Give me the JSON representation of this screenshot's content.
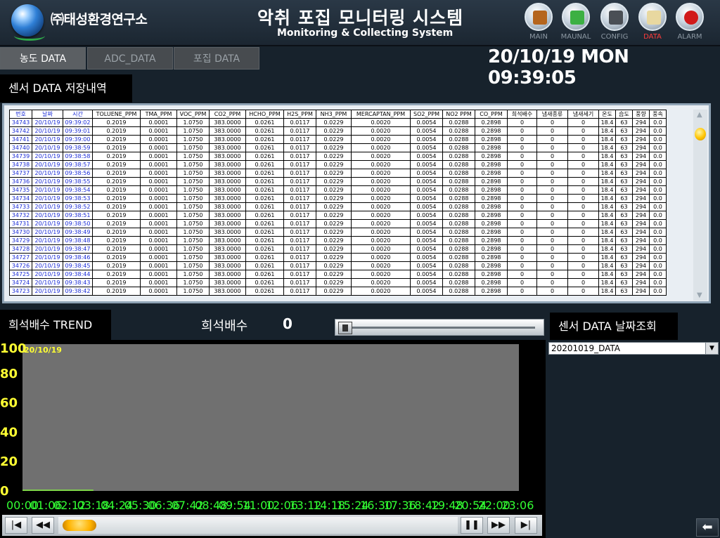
{
  "header": {
    "company": "㈜태성환경연구소",
    "title_ko": "악취 포집 모니터링 시스템",
    "title_en": "Monitoring & Collecting System",
    "nav": [
      {
        "label": "MAIN",
        "icon": "house-icon",
        "color": "#b5651d"
      },
      {
        "label": "MAUNAL",
        "icon": "book-icon",
        "color": "#3cb043"
      },
      {
        "label": "CONFIG",
        "icon": "device-icon",
        "color": "#4a4f55"
      },
      {
        "label": "DATA",
        "icon": "document-icon",
        "color": "#e8d8a0",
        "active": true
      },
      {
        "label": "ALARM",
        "icon": "alarm-icon",
        "color": "#d11a1a"
      }
    ]
  },
  "tabs": [
    {
      "label": "농도 DATA",
      "active": true
    },
    {
      "label": "ADC_DATA",
      "active": false
    },
    {
      "label": "포집 DATA",
      "active": false
    }
  ],
  "clock": {
    "date": "20/10/19",
    "day": "MON",
    "time": "09:39:05"
  },
  "sensor_section": {
    "title": "센서 DATA 저장내역"
  },
  "table": {
    "columns": [
      "번호",
      "날짜",
      "시간",
      "TOLUENE_PPM",
      "TMA_PPM",
      "VOC_PPM",
      "CO2_PPM",
      "HCHO_PPM",
      "H2S_PPM",
      "NH3_PPM",
      "MERCAPTAN_PPM",
      "SO2_PPM",
      "NO2 PPM",
      "CO_PPM",
      "희석배수",
      "냄새종류",
      "냄새세기",
      "온도",
      "습도",
      "풍향",
      "풍속"
    ],
    "rows": [
      [
        "34743",
        "20/10/19",
        "09:39:02",
        "0.2019",
        "0.0001",
        "1.0750",
        "383.0000",
        "0.0261",
        "0.0117",
        "0.0229",
        "0.0020",
        "0.0054",
        "0.0288",
        "0.2898",
        "0",
        "0",
        "0",
        "18.4",
        "63",
        "294",
        "0.0"
      ],
      [
        "34742",
        "20/10/19",
        "09:39:01",
        "0.2019",
        "0.0001",
        "1.0750",
        "383.0000",
        "0.0261",
        "0.0117",
        "0.0229",
        "0.0020",
        "0.0054",
        "0.0288",
        "0.2898",
        "0",
        "0",
        "0",
        "18.4",
        "63",
        "294",
        "0.0"
      ],
      [
        "34741",
        "20/10/19",
        "09:39:00",
        "0.2019",
        "0.0001",
        "1.0750",
        "383.0000",
        "0.0261",
        "0.0117",
        "0.0229",
        "0.0020",
        "0.0054",
        "0.0288",
        "0.2898",
        "0",
        "0",
        "0",
        "18.4",
        "63",
        "294",
        "0.0"
      ],
      [
        "34740",
        "20/10/19",
        "09:38:59",
        "0.2019",
        "0.0001",
        "1.0750",
        "383.0000",
        "0.0261",
        "0.0117",
        "0.0229",
        "0.0020",
        "0.0054",
        "0.0288",
        "0.2898",
        "0",
        "0",
        "0",
        "18.4",
        "63",
        "294",
        "0.0"
      ],
      [
        "34739",
        "20/10/19",
        "09:38:58",
        "0.2019",
        "0.0001",
        "1.0750",
        "383.0000",
        "0.0261",
        "0.0117",
        "0.0229",
        "0.0020",
        "0.0054",
        "0.0288",
        "0.2898",
        "0",
        "0",
        "0",
        "18.4",
        "63",
        "294",
        "0.0"
      ],
      [
        "34738",
        "20/10/19",
        "09:38:57",
        "0.2019",
        "0.0001",
        "1.0750",
        "383.0000",
        "0.0261",
        "0.0117",
        "0.0229",
        "0.0020",
        "0.0054",
        "0.0288",
        "0.2898",
        "0",
        "0",
        "0",
        "18.4",
        "63",
        "294",
        "0.0"
      ],
      [
        "34737",
        "20/10/19",
        "09:38:56",
        "0.2019",
        "0.0001",
        "1.0750",
        "383.0000",
        "0.0261",
        "0.0117",
        "0.0229",
        "0.0020",
        "0.0054",
        "0.0288",
        "0.2898",
        "0",
        "0",
        "0",
        "18.4",
        "63",
        "294",
        "0.0"
      ],
      [
        "34736",
        "20/10/19",
        "09:38:55",
        "0.2019",
        "0.0001",
        "1.0750",
        "383.0000",
        "0.0261",
        "0.0117",
        "0.0229",
        "0.0020",
        "0.0054",
        "0.0288",
        "0.2898",
        "0",
        "0",
        "0",
        "18.4",
        "63",
        "294",
        "0.0"
      ],
      [
        "34735",
        "20/10/19",
        "09:38:54",
        "0.2019",
        "0.0001",
        "1.0750",
        "383.0000",
        "0.0261",
        "0.0117",
        "0.0229",
        "0.0020",
        "0.0054",
        "0.0288",
        "0.2898",
        "0",
        "0",
        "0",
        "18.4",
        "63",
        "294",
        "0.0"
      ],
      [
        "34734",
        "20/10/19",
        "09:38:53",
        "0.2019",
        "0.0001",
        "1.0750",
        "383.0000",
        "0.0261",
        "0.0117",
        "0.0229",
        "0.0020",
        "0.0054",
        "0.0288",
        "0.2898",
        "0",
        "0",
        "0",
        "18.4",
        "63",
        "294",
        "0.0"
      ],
      [
        "34733",
        "20/10/19",
        "09:38:52",
        "0.2019",
        "0.0001",
        "1.0750",
        "383.0000",
        "0.0261",
        "0.0117",
        "0.0229",
        "0.0020",
        "0.0054",
        "0.0288",
        "0.2898",
        "0",
        "0",
        "0",
        "18.4",
        "63",
        "294",
        "0.0"
      ],
      [
        "34732",
        "20/10/19",
        "09:38:51",
        "0.2019",
        "0.0001",
        "1.0750",
        "383.0000",
        "0.0261",
        "0.0117",
        "0.0229",
        "0.0020",
        "0.0054",
        "0.0288",
        "0.2898",
        "0",
        "0",
        "0",
        "18.4",
        "63",
        "294",
        "0.0"
      ],
      [
        "34731",
        "20/10/19",
        "09:38:50",
        "0.2019",
        "0.0001",
        "1.0750",
        "383.0000",
        "0.0261",
        "0.0117",
        "0.0229",
        "0.0020",
        "0.0054",
        "0.0288",
        "0.2898",
        "0",
        "0",
        "0",
        "18.4",
        "63",
        "294",
        "0.0"
      ],
      [
        "34730",
        "20/10/19",
        "09:38:49",
        "0.2019",
        "0.0001",
        "1.0750",
        "383.0000",
        "0.0261",
        "0.0117",
        "0.0229",
        "0.0020",
        "0.0054",
        "0.0288",
        "0.2898",
        "0",
        "0",
        "0",
        "18.4",
        "63",
        "294",
        "0.0"
      ],
      [
        "34729",
        "20/10/19",
        "09:38:48",
        "0.2019",
        "0.0001",
        "1.0750",
        "383.0000",
        "0.0261",
        "0.0117",
        "0.0229",
        "0.0020",
        "0.0054",
        "0.0288",
        "0.2898",
        "0",
        "0",
        "0",
        "18.4",
        "63",
        "294",
        "0.0"
      ],
      [
        "34728",
        "20/10/19",
        "09:38:47",
        "0.2019",
        "0.0001",
        "1.0750",
        "383.0000",
        "0.0261",
        "0.0117",
        "0.0229",
        "0.0020",
        "0.0054",
        "0.0288",
        "0.2898",
        "0",
        "0",
        "0",
        "18.4",
        "63",
        "294",
        "0.0"
      ],
      [
        "34727",
        "20/10/19",
        "09:38:46",
        "0.2019",
        "0.0001",
        "1.0750",
        "383.0000",
        "0.0261",
        "0.0117",
        "0.0229",
        "0.0020",
        "0.0054",
        "0.0288",
        "0.2898",
        "0",
        "0",
        "0",
        "18.4",
        "63",
        "294",
        "0.0"
      ],
      [
        "34726",
        "20/10/19",
        "09:38:45",
        "0.2019",
        "0.0001",
        "1.0750",
        "383.0000",
        "0.0261",
        "0.0117",
        "0.0229",
        "0.0020",
        "0.0054",
        "0.0288",
        "0.2898",
        "0",
        "0",
        "0",
        "18.4",
        "63",
        "294",
        "0.0"
      ],
      [
        "34725",
        "20/10/19",
        "09:38:44",
        "0.2019",
        "0.0001",
        "1.0750",
        "383.0000",
        "0.0261",
        "0.0117",
        "0.0229",
        "0.0020",
        "0.0054",
        "0.0288",
        "0.2898",
        "0",
        "0",
        "0",
        "18.4",
        "63",
        "294",
        "0.0"
      ],
      [
        "34724",
        "20/10/19",
        "09:38:43",
        "0.2019",
        "0.0001",
        "1.0750",
        "383.0000",
        "0.0261",
        "0.0117",
        "0.0229",
        "0.0020",
        "0.0054",
        "0.0288",
        "0.2898",
        "0",
        "0",
        "0",
        "18.4",
        "63",
        "294",
        "0.0"
      ],
      [
        "34723",
        "20/10/19",
        "09:38:42",
        "0.2019",
        "0.0001",
        "1.0750",
        "383.0000",
        "0.0261",
        "0.0117",
        "0.0229",
        "0.0020",
        "0.0054",
        "0.0288",
        "0.2898",
        "0",
        "0",
        "0",
        "18.4",
        "63",
        "294",
        "0.0"
      ]
    ]
  },
  "trend": {
    "title": "희석배수 TREND",
    "label": "희석배수",
    "value": "0",
    "slider_fraction": 0.0
  },
  "chart_data": {
    "type": "line",
    "date_label": "20/10/19",
    "y_ticks": [
      "100",
      "80",
      "60",
      "40",
      "20",
      "0"
    ],
    "ylim": [
      0,
      100
    ],
    "x_ticks": [
      "00:00",
      "01:06",
      "02:12",
      "03:18",
      "04:24",
      "05:30",
      "06:36",
      "07:42",
      "08:48",
      "09:54",
      "11:00",
      "12:06",
      "13:12",
      "14:18",
      "15:24",
      "16:30",
      "17:36",
      "18:42",
      "19:48",
      "20:54",
      "22:00",
      "23:06"
    ],
    "series": [
      {
        "values": [
          0,
          0,
          0,
          0,
          0,
          0,
          0,
          0,
          0,
          0
        ],
        "color": "#7fd34a"
      }
    ],
    "colors": {
      "plot_bg": "#707070",
      "y_tick": "#ffff33",
      "x_tick": "#33ff33"
    }
  },
  "lookup": {
    "title": "센서 DATA 날짜조회",
    "selected": "20201019_DATA"
  }
}
